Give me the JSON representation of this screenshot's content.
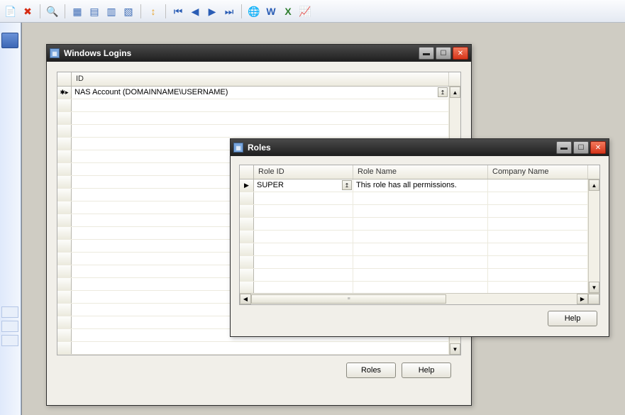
{
  "toolbar": {
    "icons": {
      "new": "📄",
      "delete": "✖",
      "find": "🔍",
      "grid1": "▦",
      "grid2": "▤",
      "grid3": "▥",
      "grid4": "▧",
      "refresh": "↕",
      "first": "⏮",
      "prev": "◀",
      "next": "▶",
      "last": "⏭",
      "globe": "🌐",
      "word": "W",
      "excel": "X",
      "chart": "📈"
    }
  },
  "win1": {
    "title": "Windows Logins",
    "columns": {
      "id": "ID"
    },
    "row": {
      "id": "NAS Account (DOMAINNAME\\USERNAME)"
    },
    "buttons": {
      "roles": "Roles",
      "help": "Help"
    }
  },
  "win2": {
    "title": "Roles",
    "columns": {
      "roleId": "Role ID",
      "roleName": "Role Name",
      "companyName": "Company Name"
    },
    "row": {
      "roleId": "SUPER",
      "roleName": "This role has all permissions."
    },
    "buttons": {
      "help": "Help"
    }
  }
}
